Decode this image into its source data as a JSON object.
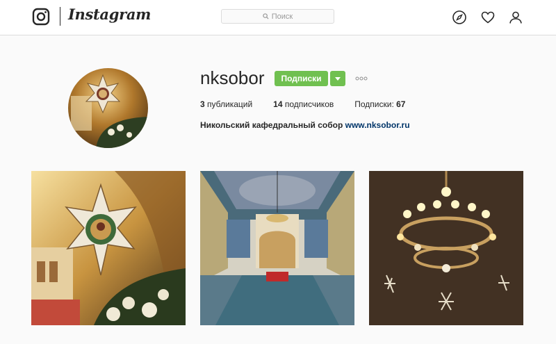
{
  "header": {
    "wordmark": "Instagram",
    "search_placeholder": "Поиск",
    "icons": [
      "instagram-logo-icon",
      "search-icon",
      "explore-compass-icon",
      "heart-icon",
      "profile-icon"
    ]
  },
  "profile": {
    "username": "nksobor",
    "follow_label": "Подписки",
    "stats": {
      "posts_count": "3",
      "posts_label": "публикаций",
      "followers_count": "14",
      "followers_label": "подписчиков",
      "following_label": "Подписки:",
      "following_count": "67"
    },
    "bio_name": "Никольский кафедральный собор",
    "bio_link": "www.nksobor.ru"
  },
  "colors": {
    "accent_green": "#70c050",
    "link_blue": "#003569",
    "border": "#dbdbdb",
    "background": "#fafafa"
  }
}
